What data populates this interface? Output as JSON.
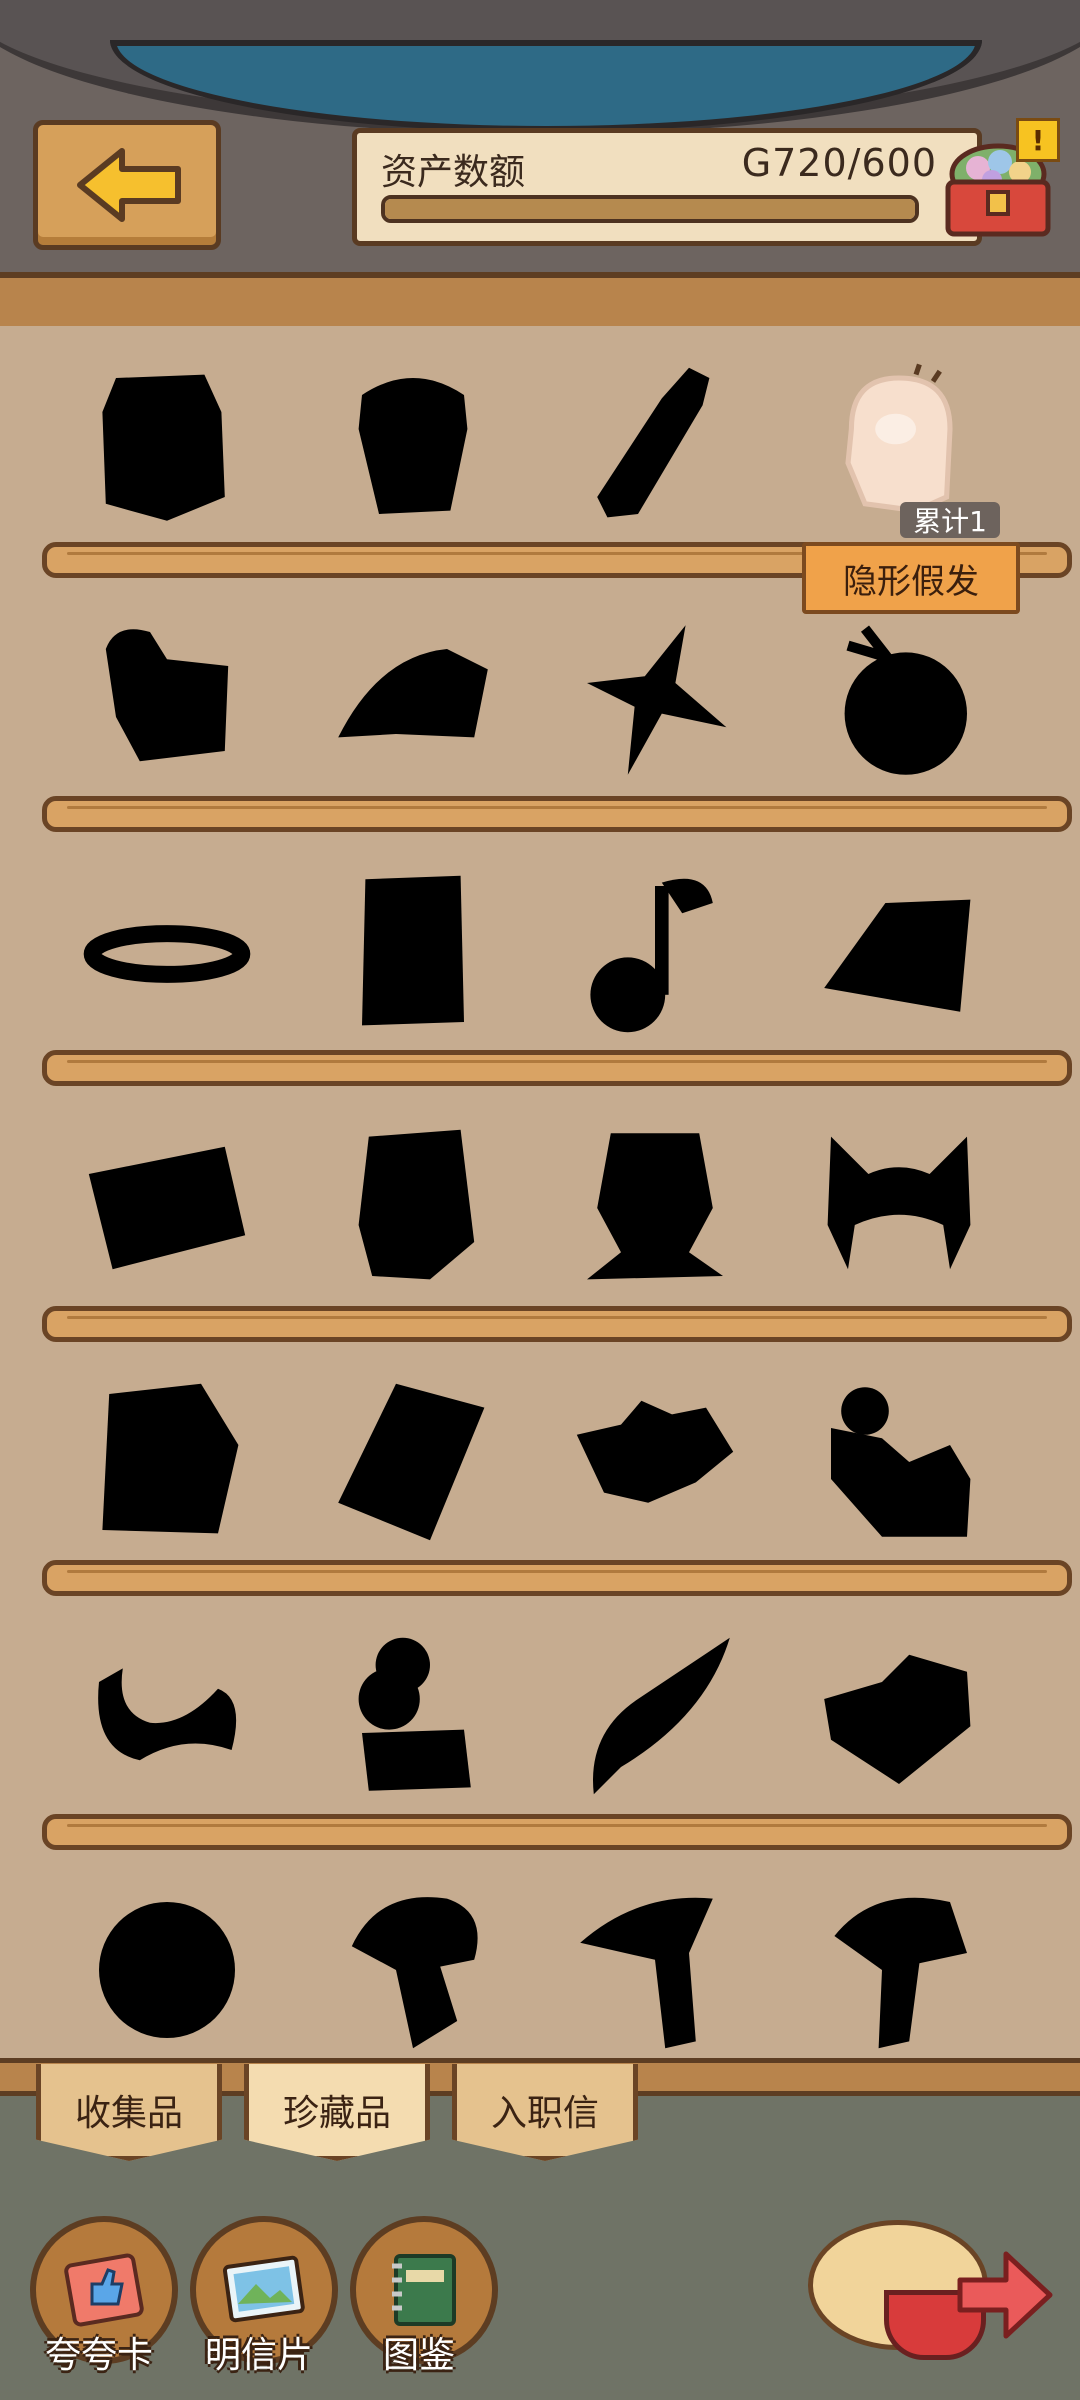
{
  "header": {
    "asset_label": "资产数额",
    "asset_value": "G720/600",
    "progress": 1.0,
    "alert": "!"
  },
  "icons": {
    "back": "back-arrow-icon",
    "chest": "treasure-chest-icon",
    "postcard": "postcard-icon",
    "praise_card": "thumbs-up-card-icon",
    "guide": "book-icon"
  },
  "unlocked_item": {
    "count": "累计1",
    "name": "隐形假发"
  },
  "tabs": [
    "收集品",
    "珍藏品",
    "入职信"
  ],
  "active_tab": "珍藏品",
  "bottom_buttons": [
    "夸夸卡",
    "明信片",
    "图鉴"
  ],
  "colors": {
    "shelf": "#d9a364",
    "badge_orange": "#f0a24a",
    "silhouette": "#000000"
  }
}
